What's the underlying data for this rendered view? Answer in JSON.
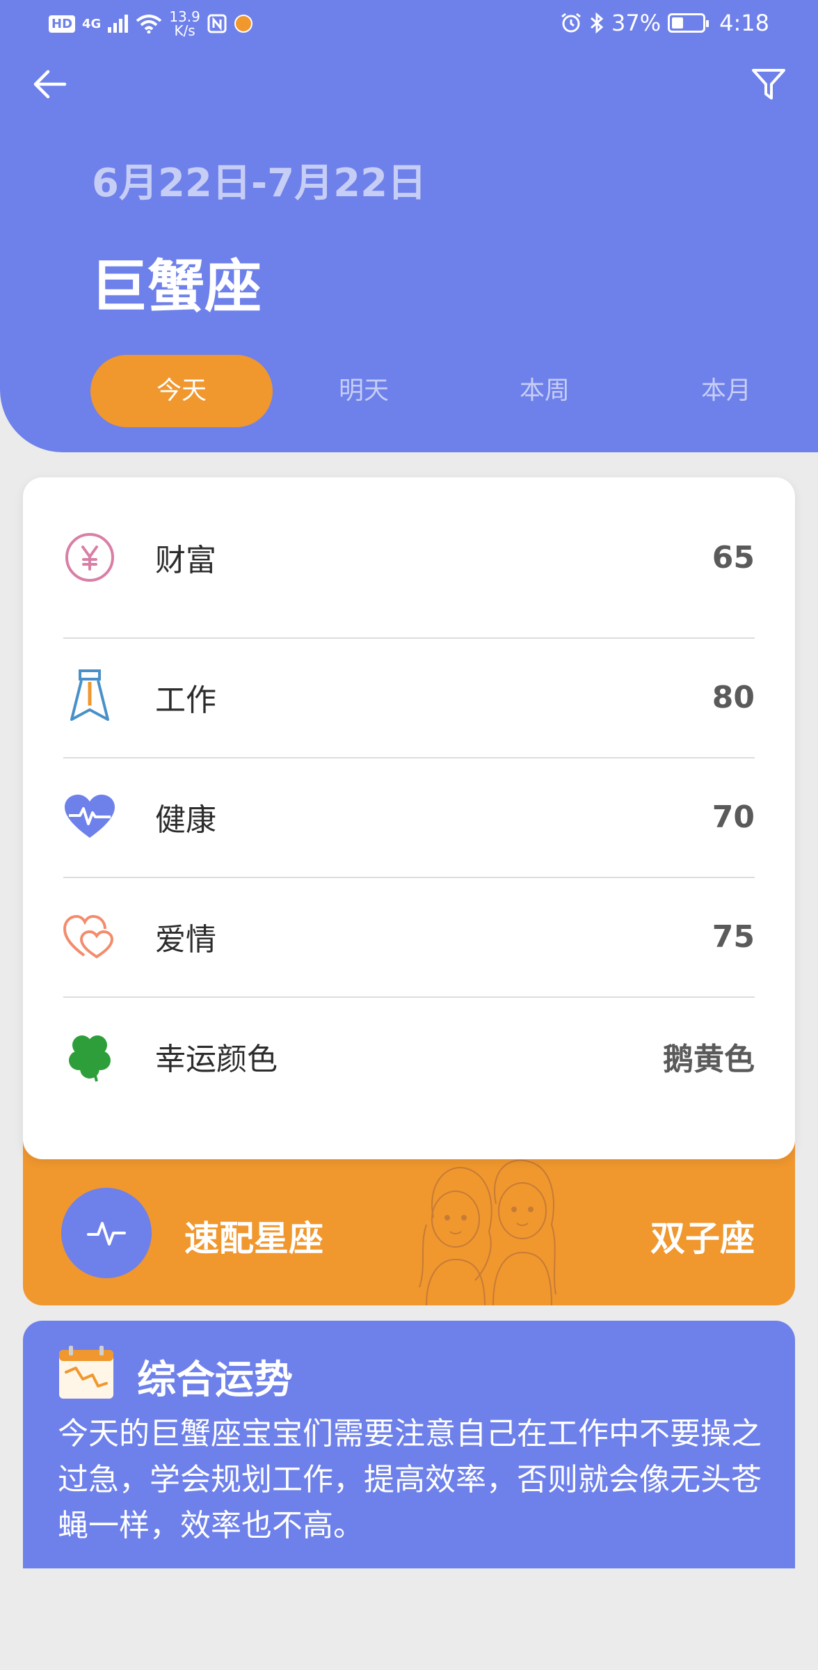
{
  "status_bar": {
    "left_badge": "HD",
    "network": "4G",
    "speed_value": "13.9",
    "speed_unit": "K/s",
    "battery": "37%",
    "battery_fraction": 0.37,
    "time": "4:18"
  },
  "header": {
    "date_range": "6月22日-7月22日",
    "sign_name": "巨蟹座",
    "tabs": [
      {
        "label": "今天",
        "active": true
      },
      {
        "label": "明天",
        "active": false
      },
      {
        "label": "本周",
        "active": false
      },
      {
        "label": "本月",
        "active": false
      }
    ]
  },
  "stats": [
    {
      "label": "财富",
      "value": "65",
      "icon": "yen-circle-icon"
    },
    {
      "label": "工作",
      "value": "80",
      "icon": "necktie-icon"
    },
    {
      "label": "健康",
      "value": "70",
      "icon": "heartbeat-icon"
    },
    {
      "label": "爱情",
      "value": "75",
      "icon": "double-heart-icon"
    },
    {
      "label": "幸运颜色",
      "value": "鹅黄色",
      "icon": "clover-icon"
    }
  ],
  "match": {
    "label": "速配星座",
    "value": "双子座",
    "icon": "pulse-icon"
  },
  "fortune": {
    "title": "综合运势",
    "text": "今天的巨蟹座宝宝们需要注意自己在工作中不要操之过急，学会规划工作，提高效率，否则就会像无头苍蝇一样，效率也不高。",
    "icon": "calendar-chart-icon"
  },
  "colors": {
    "primary": "#6E80EA",
    "accent": "#F0972E",
    "background": "#EBEBEB"
  }
}
